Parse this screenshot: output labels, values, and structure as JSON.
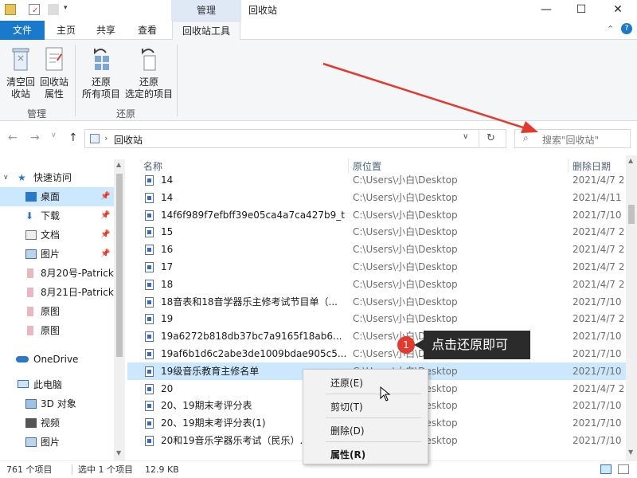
{
  "window": {
    "context_tab": "管理",
    "title": "回收站",
    "minimize": "—",
    "maximize": "☐",
    "close": "✕"
  },
  "ribbon_tabs": [
    "文件",
    "主页",
    "共享",
    "查看",
    "回收站工具"
  ],
  "ribbon": {
    "empty_label": "清空回\n收站",
    "props_label": "回收站\n属性",
    "group_manage": "管理",
    "restore_all_label": "还原\n所有项目",
    "restore_sel_label": "还原\n选定的项目",
    "group_restore": "还原"
  },
  "address": {
    "path": "回收站",
    "search_placeholder": "搜索\"回收站\""
  },
  "nav": {
    "quick_access": "快速访问",
    "items": [
      {
        "label": "桌面",
        "pinned": true
      },
      {
        "label": "下载",
        "pinned": true
      },
      {
        "label": "文档",
        "pinned": true
      },
      {
        "label": "图片",
        "pinned": true
      },
      {
        "label": "8月20号-Patrick",
        "pinned": false
      },
      {
        "label": "8月21日-Patrick",
        "pinned": false
      },
      {
        "label": "原图",
        "pinned": false
      },
      {
        "label": "原图",
        "pinned": false
      }
    ],
    "onedrive": "OneDrive",
    "this_pc": "此电脑",
    "pc_items": [
      "3D 对象",
      "视频",
      "图片"
    ]
  },
  "columns": {
    "name": "名称",
    "location": "原位置",
    "date": "删除日期"
  },
  "files": [
    {
      "name": "14",
      "location": "C:\\Users\\小白\\Desktop",
      "date": "2021/4/7 2"
    },
    {
      "name": "14",
      "location": "C:\\Users\\小白\\Desktop",
      "date": "2021/4/11"
    },
    {
      "name": "14f6f989f7efbff39e05ca4a7ca427b9_t",
      "location": "C:\\Users\\小白\\Desktop",
      "date": "2021/7/10"
    },
    {
      "name": "15",
      "location": "C:\\Users\\小白\\Desktop",
      "date": "2021/4/7 2"
    },
    {
      "name": "16",
      "location": "C:\\Users\\小白\\Desktop",
      "date": "2021/4/7 2"
    },
    {
      "name": "17",
      "location": "C:\\Users\\小白\\Desktop",
      "date": "2021/4/7 2"
    },
    {
      "name": "18",
      "location": "C:\\Users\\小白\\Desktop",
      "date": "2021/4/7 2"
    },
    {
      "name": "18音表和18音学器乐主修考试节目单（...",
      "location": "C:\\Users\\小白\\Desktop",
      "date": "2021/7/10"
    },
    {
      "name": "19",
      "location": "C:\\Users\\小白\\Desktop",
      "date": "2021/4/7 2"
    },
    {
      "name": "19a6272b818db37bc7a9165f18ab6...",
      "location": "C:\\Users\\小白\\Desktop",
      "date": "2021/7/10"
    },
    {
      "name": "19af6b1d6c2abe3de1009bdae905c5...",
      "location": "C:\\Users\\小白\\Desktop",
      "date": "2021/7/10"
    },
    {
      "name": "19级音乐教育主修名单",
      "location": "C:\\Users\\小白\\Desktop",
      "date": "2021/7/10"
    },
    {
      "name": "20",
      "location": "C:\\Users\\小白\\Desktop",
      "date": "2021/4/7 2"
    },
    {
      "name": "20、19期末考评分表",
      "location": "C:\\Users\\小白\\Desktop",
      "date": "2021/7/10"
    },
    {
      "name": "20、19期末考评分表(1)",
      "location": "C:\\Users\\小白\\Desktop",
      "date": "2021/7/10"
    },
    {
      "name": "20和19音乐学器乐考试（民乐）...",
      "location": "C:\\Users\\小白\\Desktop",
      "date": "2021/7/10"
    }
  ],
  "status": {
    "count": "761 个项目",
    "selected": "选中 1 个项目",
    "size": "12.9 KB"
  },
  "context_menu": {
    "restore": "还原(E)",
    "cut": "剪切(T)",
    "delete": "删除(D)",
    "properties": "属性(R)"
  },
  "annotation": {
    "badge": "1",
    "text": "点击还原即可"
  },
  "colors": {
    "accent": "#1979ca",
    "selection": "#cce8ff",
    "arrow": "#e23a2e"
  }
}
